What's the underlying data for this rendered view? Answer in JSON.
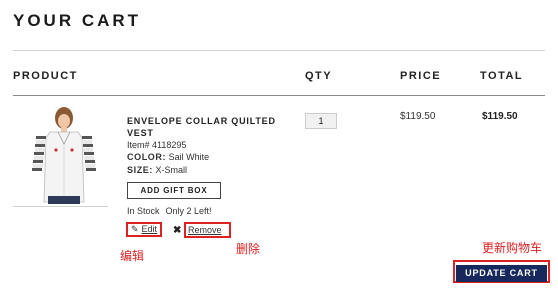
{
  "page": {
    "title": "YOUR CART"
  },
  "table": {
    "headers": {
      "product": "PRODUCT",
      "qty": "QTY",
      "price": "PRICE",
      "total": "TOTAL"
    }
  },
  "item": {
    "name": "ENVELOPE COLLAR QUILTED VEST",
    "item_number": "Item# 4118295",
    "color_label": "COLOR:",
    "color_value": "Sail White",
    "size_label": "SIZE:",
    "size_value": "X-Small",
    "gift_box_label": "ADD GIFT BOX",
    "stock_status": "In Stock",
    "stock_left": "Only 2 Left!",
    "edit_label": "Edit",
    "remove_label": "Remove",
    "quantity": "1",
    "price": "$119.50",
    "total": "$119.50",
    "image_icon": "product-photo-vest"
  },
  "actions": {
    "update_cart_label": "UPDATE CART"
  },
  "annotations": {
    "edit": "编辑",
    "remove": "删除",
    "update_cart": "更新购物车"
  },
  "colors": {
    "update_button": "#16285c",
    "annotation": "#dd2222"
  }
}
